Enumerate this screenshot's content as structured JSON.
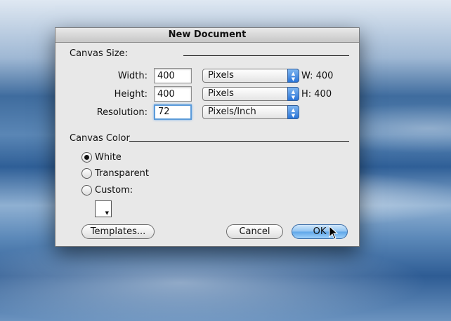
{
  "window": {
    "title": "New Document"
  },
  "canvas_size": {
    "section_label": "Canvas Size:",
    "width": {
      "label": "Width:",
      "value": "400",
      "unit": "Pixels",
      "readout": "W: 400"
    },
    "height": {
      "label": "Height:",
      "value": "400",
      "unit": "Pixels",
      "readout": "H: 400"
    },
    "resolution": {
      "label": "Resolution:",
      "value": "72",
      "unit": "Pixels/Inch"
    }
  },
  "canvas_color": {
    "section_label": "Canvas Color",
    "options": [
      {
        "label": "White",
        "checked": true
      },
      {
        "label": "Transparent",
        "checked": false
      },
      {
        "label": "Custom:",
        "checked": false
      }
    ],
    "custom_swatch_color": "#ffffff"
  },
  "buttons": {
    "templates": "Templates...",
    "cancel": "Cancel",
    "ok": "OK"
  },
  "colors": {
    "accent": "#5ea6e8",
    "dialog_bg": "#e8e8e8"
  }
}
